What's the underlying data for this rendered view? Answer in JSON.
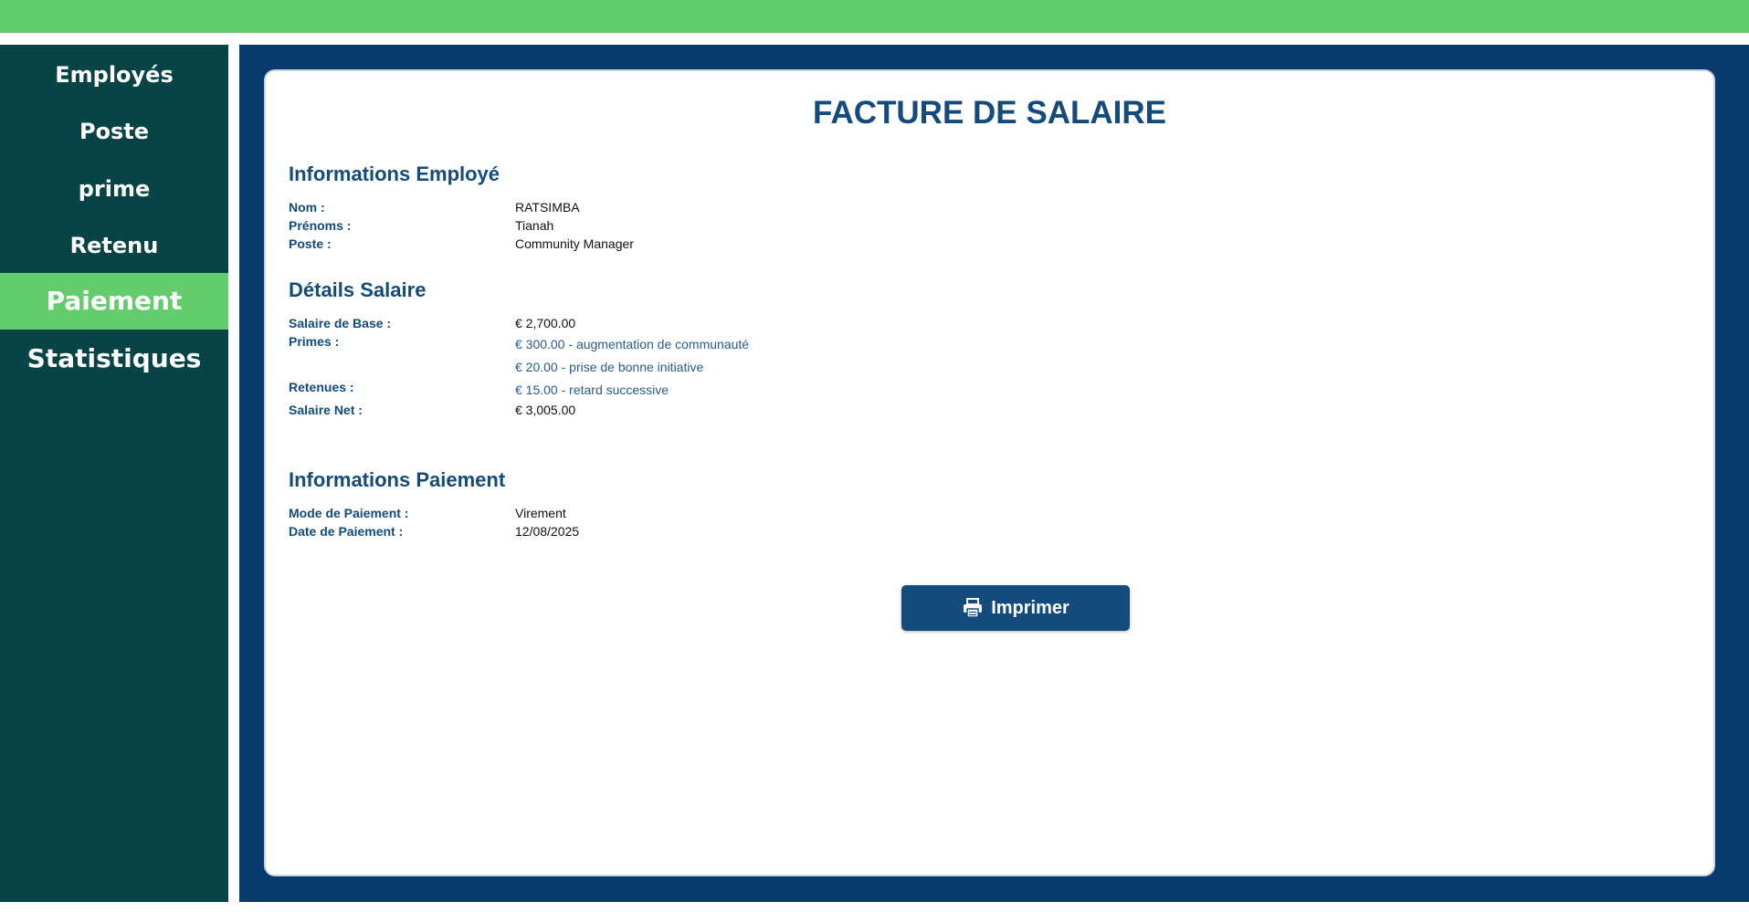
{
  "sidebar": {
    "items": [
      {
        "label": "Employés"
      },
      {
        "label": "Poste"
      },
      {
        "label": "prime"
      },
      {
        "label": "Retenu"
      },
      {
        "label": "Paiement",
        "active": true
      },
      {
        "label": "Statistiques"
      }
    ]
  },
  "invoice": {
    "title": "FACTURE DE SALAIRE",
    "employee_section": {
      "title": "Informations Employé",
      "nom_label": "Nom :",
      "nom_value": "RATSIMBA",
      "prenoms_label": "Prénoms :",
      "prenoms_value": "Tianah",
      "poste_label": "Poste :",
      "poste_value": "Community Manager"
    },
    "salary_section": {
      "title": "Détails Salaire",
      "base_label": "Salaire de Base :",
      "base_value": "€ 2,700.00",
      "primes_label": "Primes :",
      "primes": [
        "€ 300.00 - augmentation de communauté",
        "€ 20.00 - prise de bonne initiative"
      ],
      "retenues_label": "Retenues :",
      "retenues": [
        "€ 15.00 - retard successive"
      ],
      "net_label": "Salaire Net :",
      "net_value": "€ 3,005.00"
    },
    "payment_section": {
      "title": "Informations Paiement",
      "mode_label": "Mode de Paiement :",
      "mode_value": "Virement",
      "date_label": "Date de Paiement :",
      "date_value": "12/08/2025"
    },
    "print_button": {
      "label": "Imprimer",
      "icon": "printer-icon"
    }
  },
  "colors": {
    "topbar": "#63cd6e",
    "sidebar": "#084446",
    "active": "#63cd6e",
    "frame": "#093a6e",
    "heading": "#134b7c"
  }
}
